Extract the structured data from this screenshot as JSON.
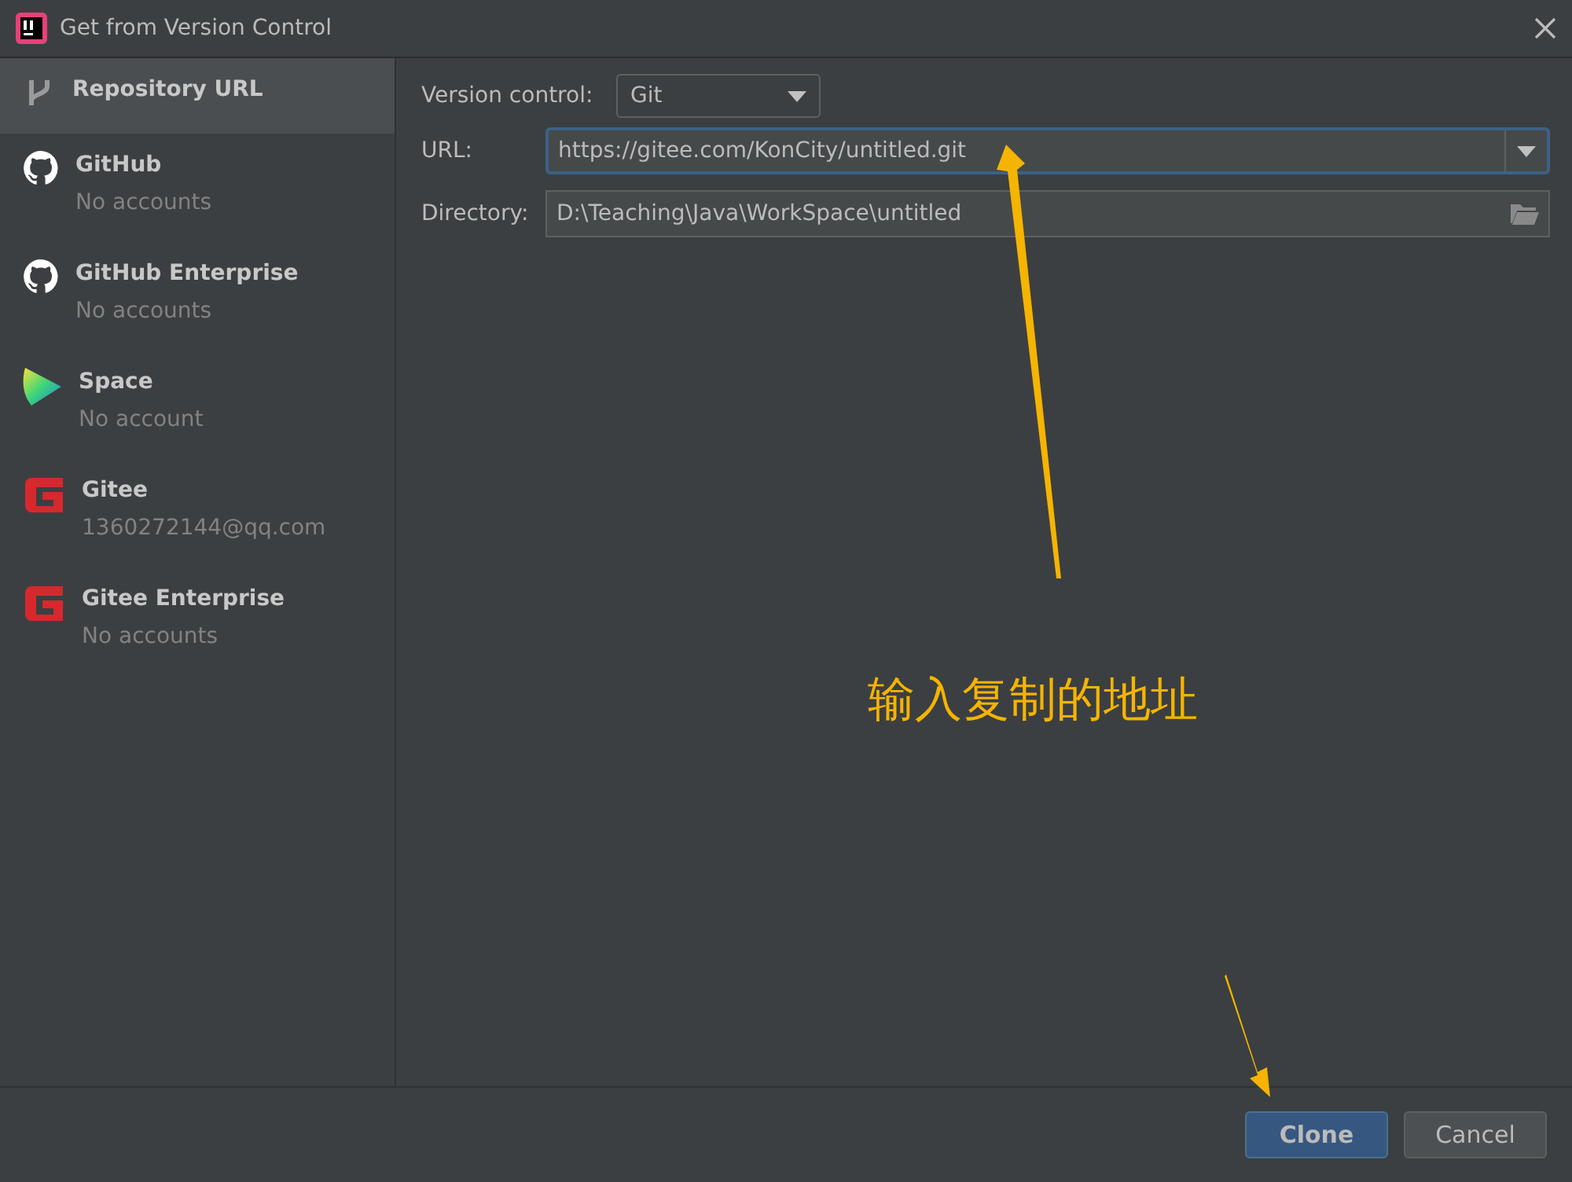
{
  "window": {
    "title": "Get from Version Control"
  },
  "sidebar": {
    "items": [
      {
        "kind": "branch",
        "label": "Repository URL",
        "selected": true
      },
      {
        "kind": "github",
        "label": "GitHub",
        "account": "No accounts",
        "selected": false
      },
      {
        "kind": "github",
        "label": "GitHub Enterprise",
        "account": "No accounts",
        "selected": false
      },
      {
        "kind": "space",
        "label": "Space",
        "account": "No account",
        "selected": false
      },
      {
        "kind": "gitee",
        "label": "Gitee",
        "account": "1360272144@qq.com",
        "selected": false
      },
      {
        "kind": "gitee",
        "label": "Gitee Enterprise",
        "account": "No accounts",
        "selected": false
      }
    ]
  },
  "form": {
    "version_control": {
      "label": "Version control:",
      "value": "Git"
    },
    "url": {
      "label": "URL:",
      "value": "https://gitee.com/KonCity/untitled.git"
    },
    "directory": {
      "label": "Directory:",
      "value": "D:\\Teaching\\Java\\WorkSpace\\untitled"
    }
  },
  "annotation": {
    "text": "输入复制的地址"
  },
  "buttons": [
    {
      "label": "Clone",
      "kind": "primary"
    },
    {
      "label": "Cancel",
      "kind": "secondary"
    }
  ]
}
